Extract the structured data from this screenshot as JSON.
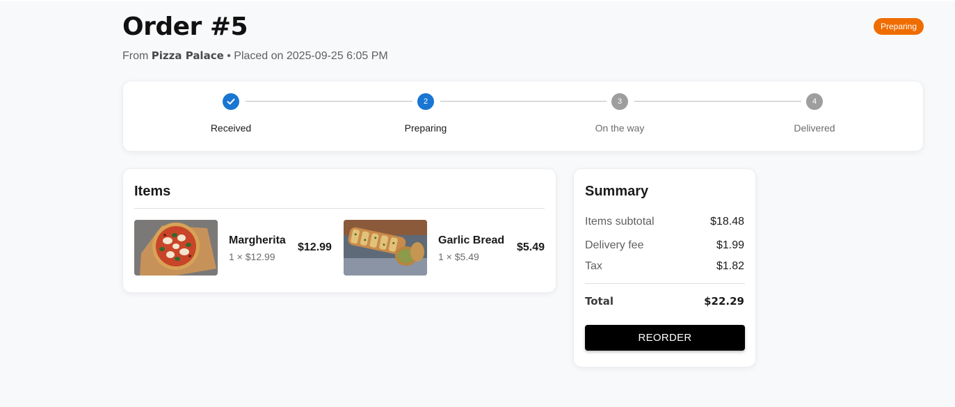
{
  "order": {
    "title": "Order #5",
    "from_prefix": "From",
    "restaurant": "Pizza Palace",
    "placed_text": "• Placed on 2025-09-25 6:05 PM",
    "status": "Preparing",
    "status_color": "#ef6c00"
  },
  "stepper": {
    "steps": [
      {
        "label": "Received",
        "number": "1",
        "state": "done"
      },
      {
        "label": "Preparing",
        "number": "2",
        "state": "active"
      },
      {
        "label": "On the way",
        "number": "3",
        "state": "pending"
      },
      {
        "label": "Delivered",
        "number": "4",
        "state": "pending"
      }
    ],
    "active_color": "#1976d2",
    "pending_color": "#9e9e9e"
  },
  "items": {
    "title": "Items",
    "list": [
      {
        "name": "Margherita",
        "qty": "1 × $12.99",
        "price": "$12.99",
        "image": "pizza-image"
      },
      {
        "name": "Garlic Bread",
        "qty": "1 × $5.49",
        "price": "$5.49",
        "image": "garlic-bread-image"
      }
    ]
  },
  "summary": {
    "title": "Summary",
    "rows": [
      {
        "label": "Items subtotal",
        "value": "$18.48"
      },
      {
        "label": "Delivery fee",
        "value": "$1.99"
      },
      {
        "label": "Tax",
        "value": "$1.82"
      }
    ],
    "total_label": "Total",
    "total_value": "$22.29",
    "reorder_label": "REORDER"
  }
}
